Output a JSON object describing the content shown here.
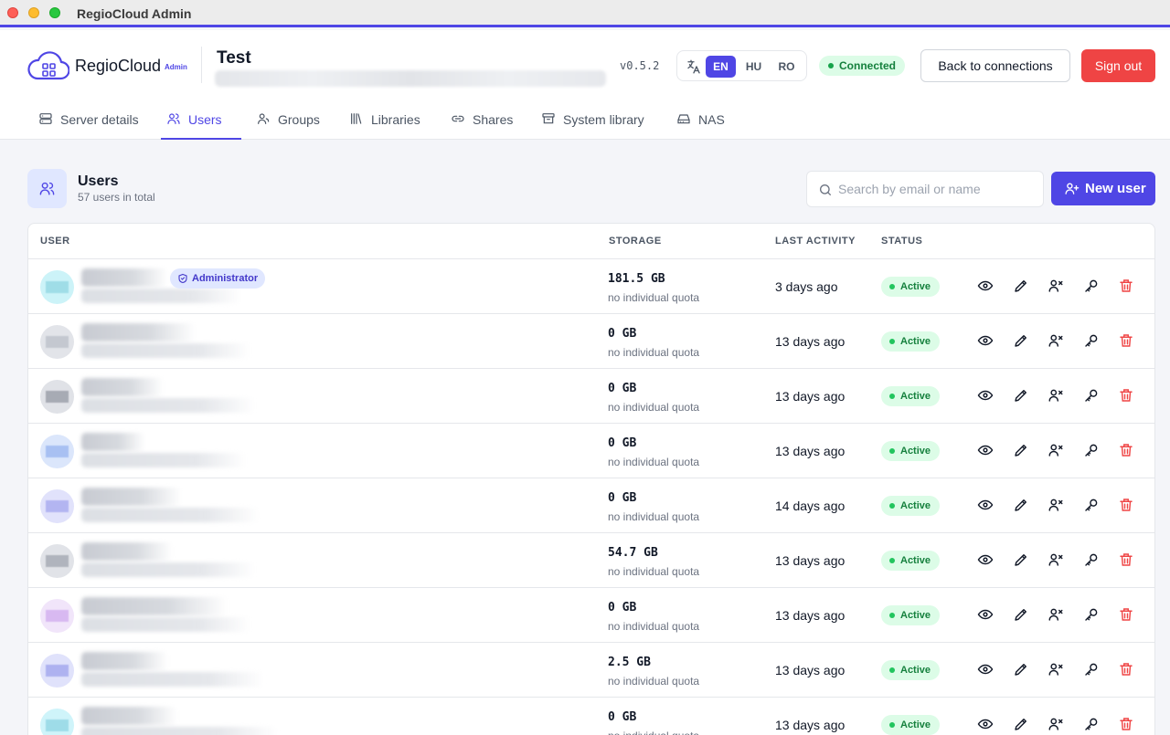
{
  "window": {
    "title": "RegioCloud Admin"
  },
  "brand": {
    "name": "RegioCloud",
    "sub": "Admin"
  },
  "connection": {
    "name": "Test",
    "version": "v0.5.2",
    "status": "Connected"
  },
  "languages": [
    {
      "code": "EN",
      "active": true
    },
    {
      "code": "HU",
      "active": false
    },
    {
      "code": "RO",
      "active": false
    }
  ],
  "header_buttons": {
    "back": "Back to connections",
    "signout": "Sign out"
  },
  "tabs": [
    {
      "label": "Server details",
      "icon": "server-icon"
    },
    {
      "label": "Users",
      "icon": "users-icon",
      "active": true
    },
    {
      "label": "Groups",
      "icon": "groups-icon"
    },
    {
      "label": "Libraries",
      "icon": "libraries-icon"
    },
    {
      "label": "Shares",
      "icon": "link-icon"
    },
    {
      "label": "System library",
      "icon": "archive-icon"
    },
    {
      "label": "NAS",
      "icon": "drive-icon"
    }
  ],
  "users_section": {
    "title": "Users",
    "count_text": "57 users in total",
    "search_placeholder": "Search by email or name",
    "new_user_label": "New user"
  },
  "table": {
    "columns": {
      "user": "USER",
      "storage": "STORAGE",
      "last_activity": "LAST ACTIVITY",
      "status": "STATUS"
    },
    "admin_badge": "Administrator",
    "rows": [
      {
        "storage": "181.5 GB",
        "quota": "no individual quota",
        "activity": "3 days ago",
        "status": "Active",
        "admin": true,
        "avatar_color": "#ccf3f8",
        "avatar_inner": "#9fdde7"
      },
      {
        "storage": "0 GB",
        "quota": "no individual quota",
        "activity": "13 days ago",
        "status": "Active",
        "avatar_color": "#e2e4e9",
        "avatar_inner": "#c4c8d0"
      },
      {
        "storage": "0 GB",
        "quota": "no individual quota",
        "activity": "13 days ago",
        "status": "Active",
        "avatar_color": "#e0e2e7",
        "avatar_inner": "#a7abb4"
      },
      {
        "storage": "0 GB",
        "quota": "no individual quota",
        "activity": "13 days ago",
        "status": "Active",
        "avatar_color": "#dbe6fb",
        "avatar_inner": "#a8c0f2"
      },
      {
        "storage": "0 GB",
        "quota": "no individual quota",
        "activity": "14 days ago",
        "status": "Active",
        "avatar_color": "#e1e2fb",
        "avatar_inner": "#b3b5f1"
      },
      {
        "storage": "54.7 GB",
        "quota": "no individual quota",
        "activity": "13 days ago",
        "status": "Active",
        "avatar_color": "#e1e3e8",
        "avatar_inner": "#b0b4bd"
      },
      {
        "storage": "0 GB",
        "quota": "no individual quota",
        "activity": "13 days ago",
        "status": "Active",
        "avatar_color": "#f1e5fa",
        "avatar_inner": "#d8b9f1"
      },
      {
        "storage": "2.5 GB",
        "quota": "no individual quota",
        "activity": "13 days ago",
        "status": "Active",
        "avatar_color": "#e0e2fb",
        "avatar_inner": "#aeb2f0"
      },
      {
        "storage": "0 GB",
        "quota": "no individual quota",
        "activity": "13 days ago",
        "status": "Active",
        "avatar_color": "#cff4fa",
        "avatar_inner": "#9edce8"
      }
    ]
  },
  "colors": {
    "accent": "#4f46e5",
    "danger": "#ef4444",
    "success": "#15803d"
  }
}
